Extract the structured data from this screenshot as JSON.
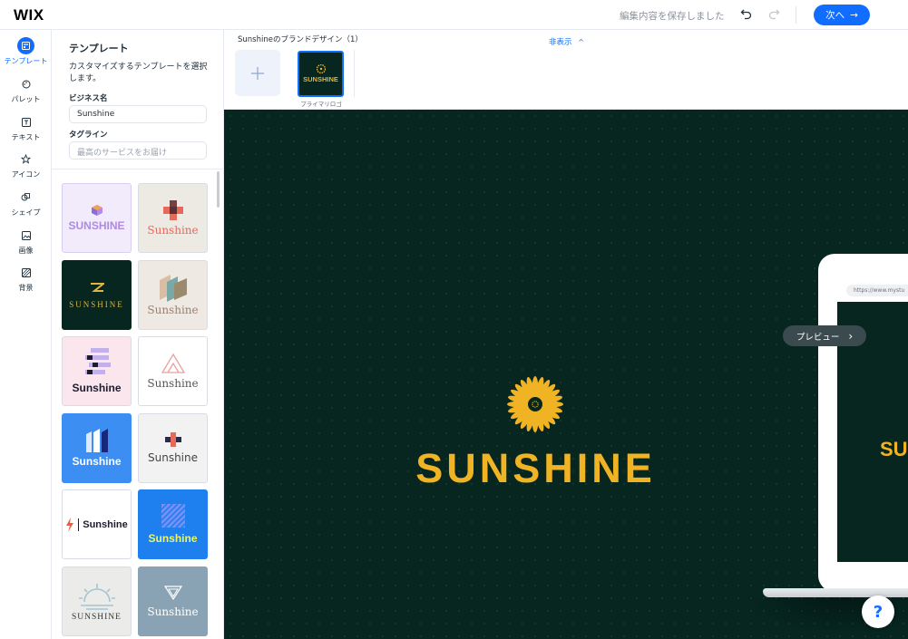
{
  "app": {
    "logo": "WIX"
  },
  "topbar": {
    "saved_status": "編集内容を保存しました",
    "next_label": "次へ",
    "accent": "#116dff"
  },
  "rail": [
    {
      "label": "テンプレート",
      "icon": "template-icon",
      "active": true
    },
    {
      "label": "パレット",
      "icon": "palette-icon"
    },
    {
      "label": "テキスト",
      "icon": "text-icon"
    },
    {
      "label": "アイコン",
      "icon": "star-icon"
    },
    {
      "label": "シェイプ",
      "icon": "shape-icon"
    },
    {
      "label": "画像",
      "icon": "image-icon"
    },
    {
      "label": "背景",
      "icon": "background-icon"
    }
  ],
  "panel": {
    "title": "テンプレート",
    "description": "カスタマイズするテンプレートを選択します。",
    "business_label": "ビジネス名",
    "business_value": "Sunshine",
    "tagline_label": "タグライン",
    "tagline_placeholder": "最高のサービスをお届け"
  },
  "templates": [
    {
      "text": "SUNSHINE",
      "bg": "#f1ebfb",
      "color": "#b08ae0"
    },
    {
      "text": "Sunshine",
      "bg": "#ede9e3",
      "color": "#e8695a"
    },
    {
      "text": "SUNSHINE",
      "bg": "#06261f",
      "color": "#e0b640"
    },
    {
      "text": "Sunshine",
      "bg": "#efe9e3",
      "color": "#9b7f70"
    },
    {
      "text": "Sunshine",
      "bg": "#fbe6ee",
      "color": "#1c1c2e"
    },
    {
      "text": "Sunshine",
      "bg": "#ffffff",
      "color": "#555555"
    },
    {
      "text": "Sunshine",
      "bg": "#3d8ef2",
      "color": "#ffffff"
    },
    {
      "text": "Sunshine",
      "bg": "#f2f2f2",
      "color": "#444444"
    },
    {
      "text": "Sunshine",
      "bg": "#ffffff",
      "color": "#1c1c2e"
    },
    {
      "text": "Sunshine",
      "bg": "#1e80ef",
      "color": "#e9f56a"
    },
    {
      "text": "SUNSHINE",
      "bg": "#ebebea",
      "color": "#333333"
    },
    {
      "text": "Sunshine",
      "bg": "#8aa3b4",
      "color": "#ffffff"
    }
  ],
  "strip": {
    "title": "Sunshineのブランドデザイン（1）",
    "hide_label": "非表示",
    "primary_logo_label": "プライマリロゴ",
    "primary_logo_text": "SUNSHINE"
  },
  "canvas": {
    "brand_text": "SUNSHINE",
    "brand_color": "#f0b323",
    "bg_color": "#06261f",
    "preview_label": "プレビュー",
    "laptop_url": "https://www.mystu",
    "laptop_brand": "SU",
    "help_label": "?"
  }
}
